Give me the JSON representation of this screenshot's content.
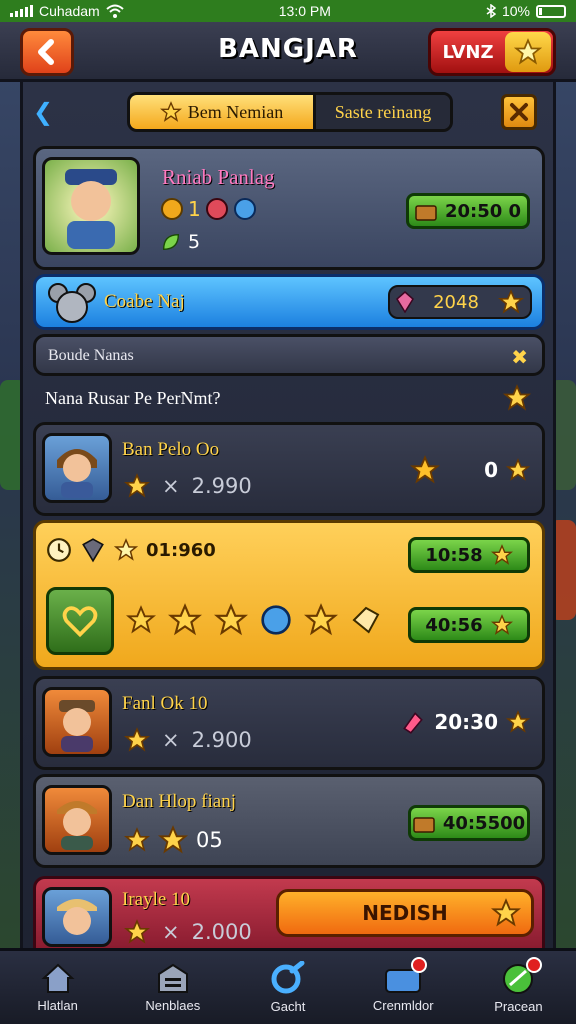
{
  "status_bar": {
    "carrier": "Cuhadam",
    "time": "13:0 PM",
    "battery": "10%"
  },
  "header": {
    "title": "BANGJAR",
    "level_button": "LVNZ"
  },
  "tabs": {
    "active": "Bem Nemian",
    "inactive": "Saste reinang"
  },
  "profile": {
    "name": "Rniab Panlag",
    "coin_count": "1",
    "level": "5",
    "reward": "20:50 0"
  },
  "sub_player": {
    "name": "Coabe Naj",
    "value": "2048"
  },
  "section": {
    "title": "Boude Nanas"
  },
  "question": {
    "text": "Nana Rusar Pe PerNmt?"
  },
  "players": [
    {
      "name": "Ban Pelo Oo",
      "score": "2.990",
      "right_value": "0"
    },
    {
      "name": "Fanl Ok 10",
      "score": "2.900",
      "right_value": "20:30"
    },
    {
      "name": "Dan Hlop fianj",
      "score": "05",
      "right_value": "40:5500"
    },
    {
      "name": "Irayle 10",
      "score": "2.000"
    }
  ],
  "gold_card": {
    "label": "01:960",
    "value_top": "10:58",
    "value_bottom": "40:56"
  },
  "cta": {
    "label": "NEDISH"
  },
  "bottom_nav": [
    "Hlatlan",
    "Nenblaes",
    "Gacht",
    "Crenmldor",
    "Pracean"
  ],
  "colors": {
    "accent_gold": "#ffd34a",
    "accent_green": "#2d8a18",
    "accent_red": "#e02020",
    "accent_blue": "#1c80e0"
  }
}
